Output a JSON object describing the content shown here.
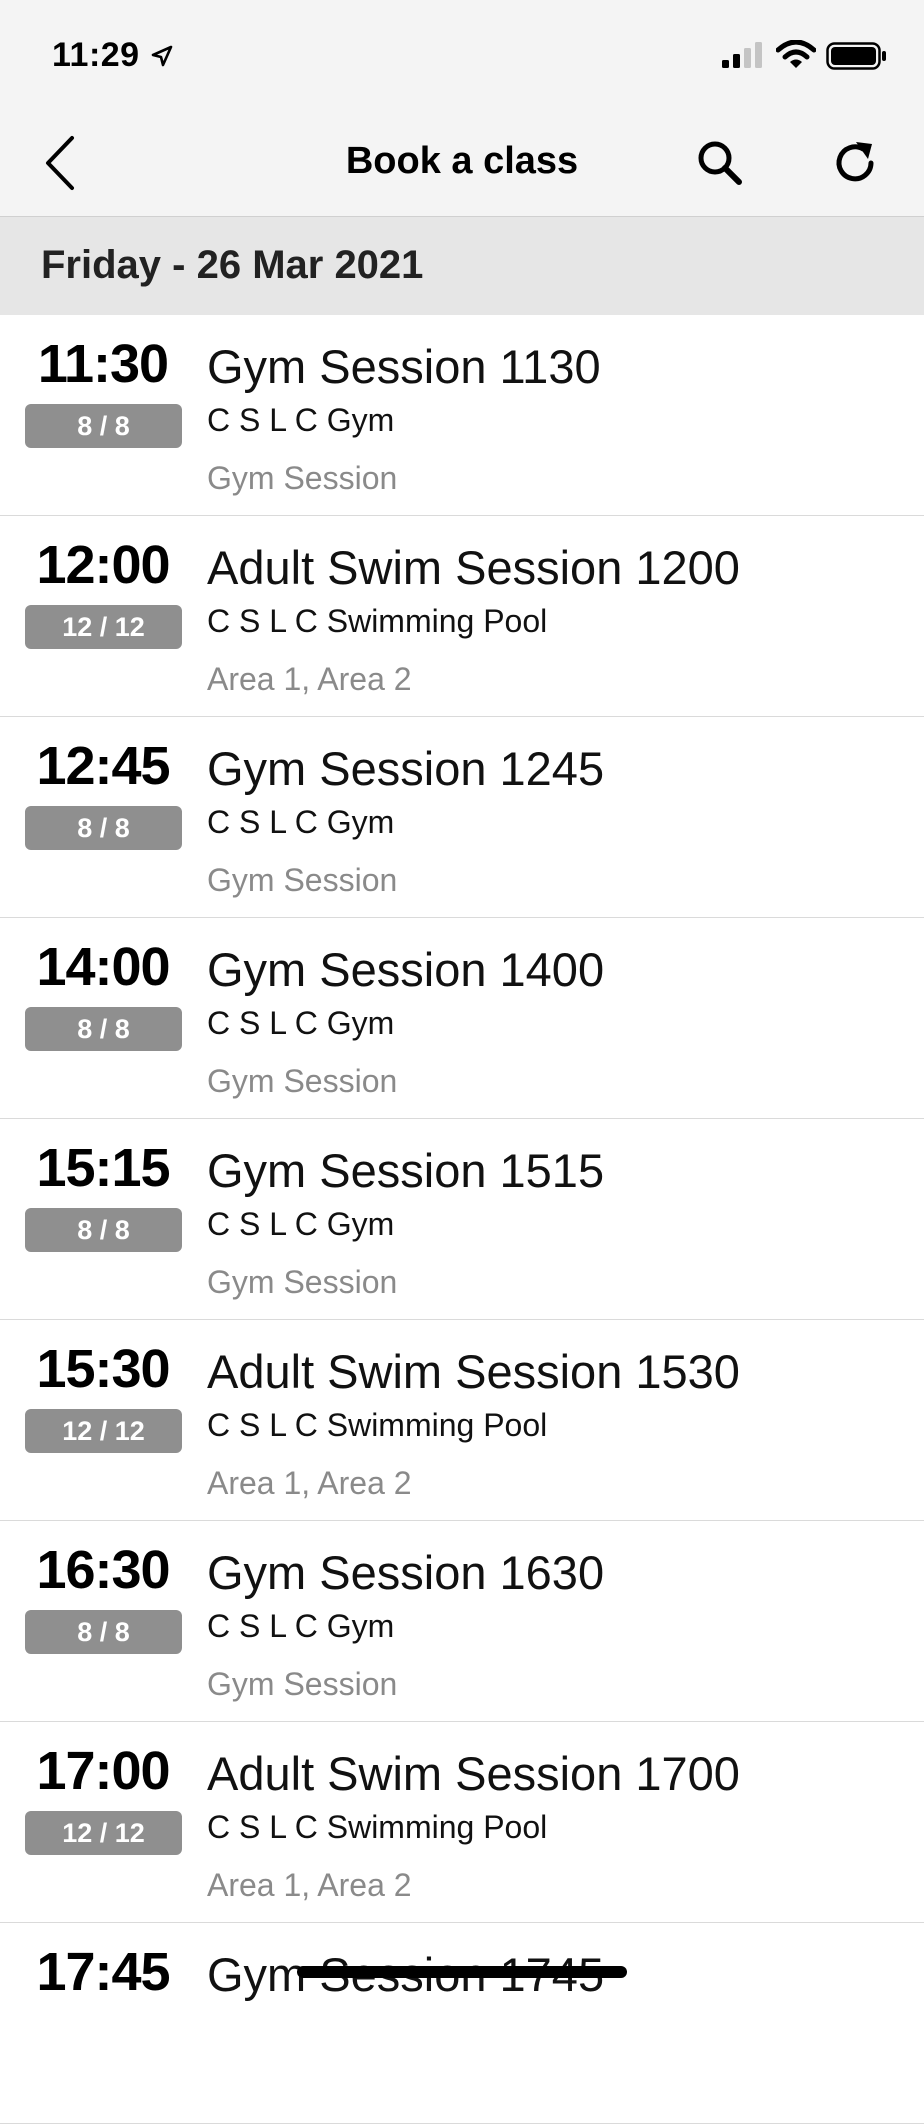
{
  "status_bar": {
    "time": "11:29"
  },
  "nav": {
    "title": "Book a class"
  },
  "date_header": "Friday - 26 Mar 2021",
  "sessions": [
    {
      "time": "11:30",
      "spaces": "8 / 8",
      "name": "Gym Session 1130",
      "location": "C S L C Gym",
      "area": "Gym Session"
    },
    {
      "time": "12:00",
      "spaces": "12 / 12",
      "name": "Adult Swim Session 1200",
      "location": "C S L C Swimming Pool",
      "area": "Area 1, Area 2"
    },
    {
      "time": "12:45",
      "spaces": "8 / 8",
      "name": "Gym Session 1245",
      "location": "C S L C Gym",
      "area": "Gym Session"
    },
    {
      "time": "14:00",
      "spaces": "8 / 8",
      "name": "Gym Session 1400",
      "location": "C S L C Gym",
      "area": "Gym Session"
    },
    {
      "time": "15:15",
      "spaces": "8 / 8",
      "name": "Gym Session 1515",
      "location": "C S L C Gym",
      "area": "Gym Session"
    },
    {
      "time": "15:30",
      "spaces": "12 / 12",
      "name": "Adult Swim Session 1530",
      "location": "C S L C Swimming Pool",
      "area": "Area 1, Area 2"
    },
    {
      "time": "16:30",
      "spaces": "8 / 8",
      "name": "Gym Session 1630",
      "location": "C S L C Gym",
      "area": "Gym Session"
    },
    {
      "time": "17:00",
      "spaces": "12 / 12",
      "name": "Adult Swim Session 1700",
      "location": "C S L C Swimming Pool",
      "area": "Area 1, Area 2"
    },
    {
      "time": "17:45",
      "spaces": "",
      "name": "Gym Session 1745",
      "location": "",
      "area": ""
    }
  ],
  "colors": {
    "bar_background": "#f4f4f4",
    "date_header_background": "#e6e6e6",
    "badge_background": "#8f8f8f",
    "secondary_text": "#8a8a8a"
  }
}
